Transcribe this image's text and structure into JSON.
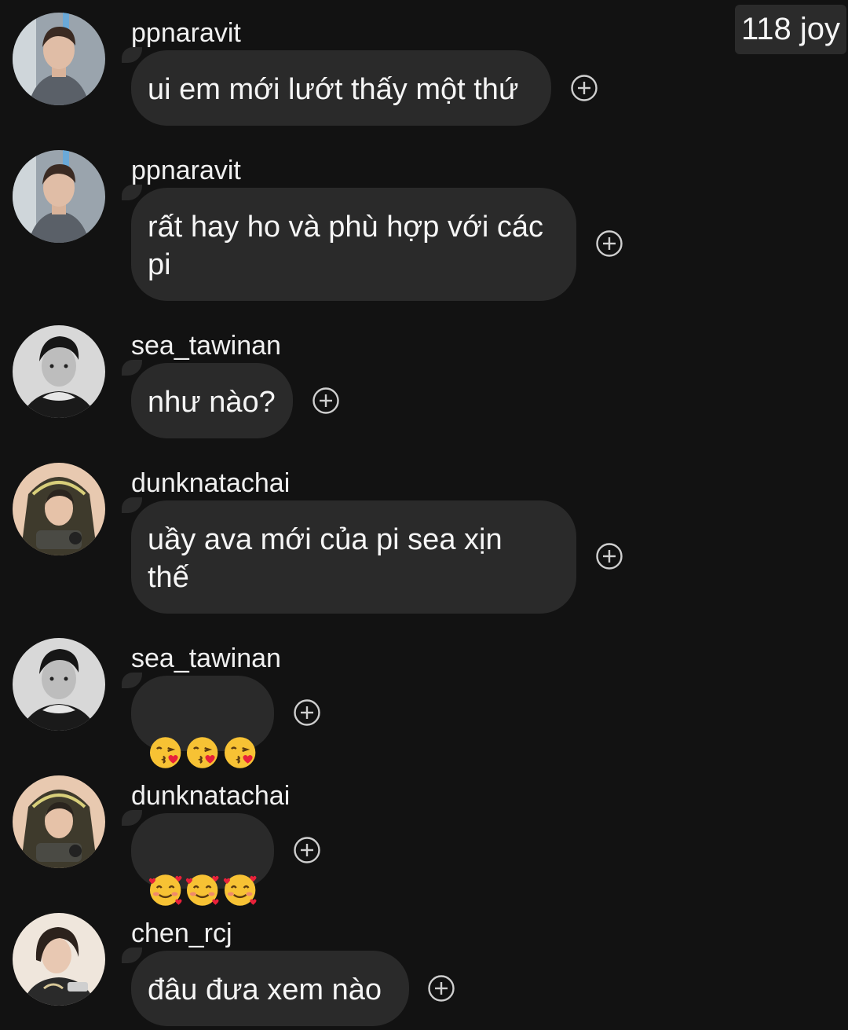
{
  "header": {
    "badge": "118 joy"
  },
  "messages": [
    {
      "username": "ppnaravit",
      "text": "ui em mới lướt thấy một thứ",
      "avatar": "avatar-ppnaravit"
    },
    {
      "username": "ppnaravit",
      "text": "rất hay ho và phù hợp với các\npi",
      "avatar": "avatar-ppnaravit"
    },
    {
      "username": "sea_tawinan",
      "text": "như nào?",
      "avatar": "avatar-sea_tawinan"
    },
    {
      "username": "dunknatachai",
      "text": "uầy ava mới của pi sea xịn\nthế",
      "avatar": "avatar-dunknatachai"
    },
    {
      "username": "sea_tawinan",
      "text": "",
      "emoji": [
        "kissing-heart-emoji",
        "kissing-heart-emoji",
        "kissing-heart-emoji"
      ],
      "avatar": "avatar-sea_tawinan"
    },
    {
      "username": "dunknatachai",
      "text": "",
      "emoji": [
        "smiling-hearts-emoji",
        "smiling-hearts-emoji",
        "smiling-hearts-emoji"
      ],
      "avatar": "avatar-dunknatachai"
    },
    {
      "username": "chen_rcj",
      "text": "đâu đưa xem nào",
      "avatar": "avatar-chen_rcj"
    }
  ],
  "icons": {
    "react": "add-reaction-icon",
    "react_color": "#cfcfcf"
  },
  "colors": {
    "background": "#121212",
    "bubble": "#2a2a2a",
    "text": "#f5f5f5"
  }
}
